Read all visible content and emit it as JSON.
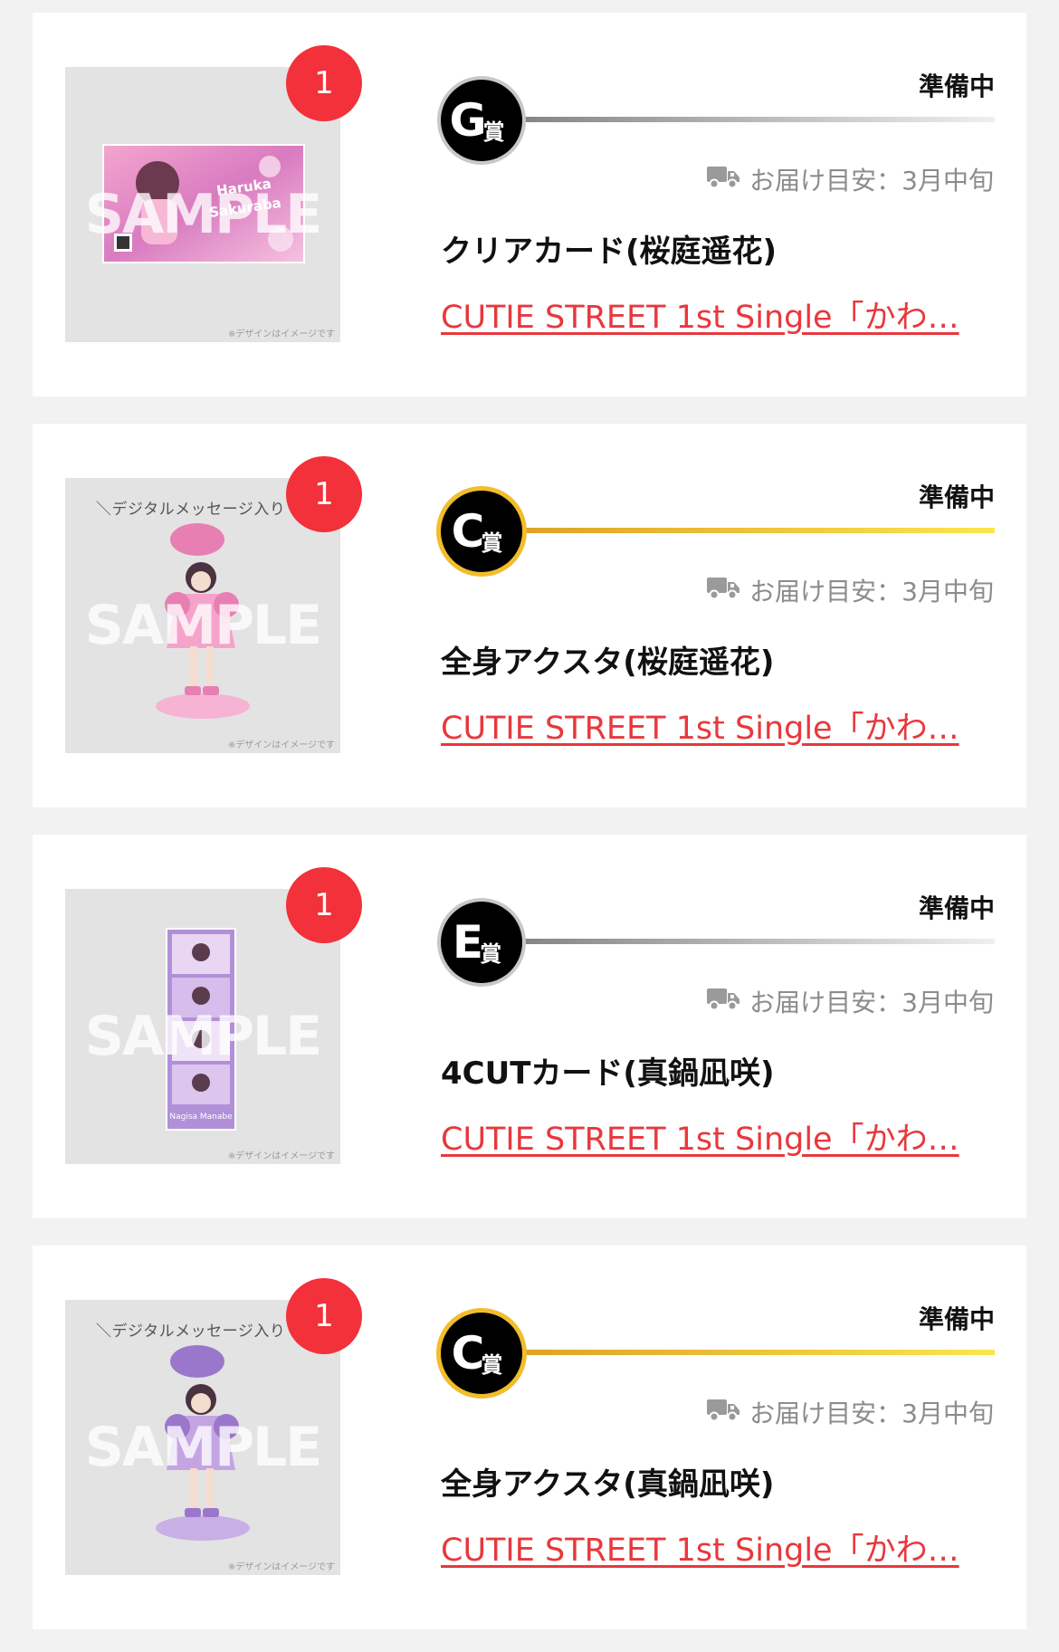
{
  "items": [
    {
      "quantity": "1",
      "rank_letter": "G",
      "rank_suffix": "賞",
      "rank_style": "gray",
      "status": "準備中",
      "delivery": "お届け目安：3月中旬",
      "product_name": "クリアカード(桜庭遥花)",
      "series_link": "CUTIE STREET 1st Single「かわ…",
      "sample_text": "SAMPLE",
      "image_note": "※デザインはイメージです",
      "image_caption": "",
      "art_kind": "card",
      "art_texts": [
        "Haruka",
        "Sakuraba"
      ],
      "icons": {
        "truck": "truck-icon"
      }
    },
    {
      "quantity": "1",
      "rank_letter": "C",
      "rank_suffix": "賞",
      "rank_style": "gold",
      "status": "準備中",
      "delivery": "お届け目安：3月中旬",
      "product_name": "全身アクスタ(桜庭遥花)",
      "series_link": "CUTIE STREET 1st Single「かわ…",
      "sample_text": "SAMPLE",
      "image_note": "※デザインはイメージです",
      "image_caption": "＼デジタルメッセージ入り",
      "art_kind": "stand-pink",
      "art_texts": [],
      "icons": {
        "truck": "truck-icon"
      }
    },
    {
      "quantity": "1",
      "rank_letter": "E",
      "rank_suffix": "賞",
      "rank_style": "gray",
      "status": "準備中",
      "delivery": "お届け目安：3月中旬",
      "product_name": "4CUTカード(真鍋凪咲)",
      "series_link": "CUTIE STREET 1st Single「かわ…",
      "sample_text": "SAMPLE",
      "image_note": "※デザインはイメージです",
      "image_caption": "",
      "art_kind": "fourcut",
      "art_texts": [
        "Nagisa Manabe"
      ],
      "icons": {
        "truck": "truck-icon"
      }
    },
    {
      "quantity": "1",
      "rank_letter": "C",
      "rank_suffix": "賞",
      "rank_style": "gold",
      "status": "準備中",
      "delivery": "お届け目安：3月中旬",
      "product_name": "全身アクスタ(真鍋凪咲)",
      "series_link": "CUTIE STREET 1st Single「かわ…",
      "sample_text": "SAMPLE",
      "image_note": "※デザインはイメージです",
      "image_caption": "＼デジタルメッセージ入り",
      "art_kind": "stand-purple",
      "art_texts": [],
      "icons": {
        "truck": "truck-icon"
      }
    }
  ]
}
